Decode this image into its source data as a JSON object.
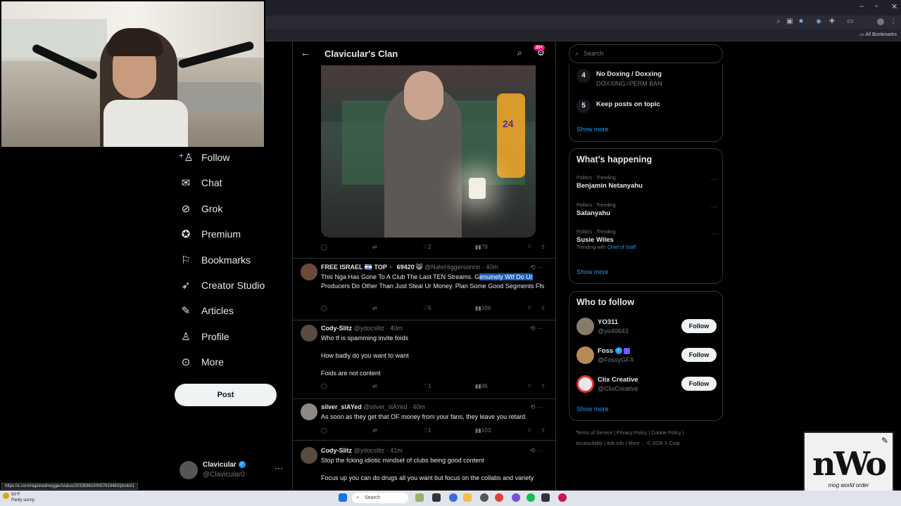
{
  "browser": {
    "window_controls": [
      "–",
      "▫",
      "✕"
    ],
    "bookmarks_folder": "All Bookmarks"
  },
  "nav": {
    "items": [
      {
        "label": "Follow",
        "icon": "follow-icon"
      },
      {
        "label": "Chat",
        "icon": "chat-icon"
      },
      {
        "label": "Grok",
        "icon": "grok-icon"
      },
      {
        "label": "Premium",
        "icon": "premium-icon"
      },
      {
        "label": "Bookmarks",
        "icon": "bookmark-icon"
      },
      {
        "label": "Creator Studio",
        "icon": "rocket-icon"
      },
      {
        "label": "Articles",
        "icon": "articles-icon"
      },
      {
        "label": "Profile",
        "icon": "profile-icon"
      },
      {
        "label": "More",
        "icon": "more-icon"
      }
    ],
    "post_label": "Post",
    "account": {
      "name": "Clavicular",
      "handle": "@Clavicular0"
    }
  },
  "header": {
    "title": "Clavicular's Clan",
    "badge": "20+"
  },
  "media_post": {
    "jersey_number": "24",
    "actions": {
      "replies": "",
      "reposts": "",
      "likes": "2",
      "views": "79"
    }
  },
  "tweets": [
    {
      "name": "FREE ISRAEL 🇮🇱 TOP▪️ 69420 😸",
      "handle": "@NateHiggersonnn",
      "time": "· 40m",
      "lines_pre": "This Nga Has Gone To A Club The Last TEN Streams. G",
      "lines_hl": "enuinely Wtf Do Ur",
      "lines_post": "Producers Do Other Than Just Steal Ur Money. Plan Some Good Segments Ffs",
      "likes": "5",
      "views": "106"
    },
    {
      "name": "Cody-Slitz",
      "handle": "@ydocslitz",
      "time": "· 40m",
      "line1": "Who tf is spamming invite foids",
      "line2": "How badly do you want to want",
      "line3": "Foids are not content",
      "likes": "1",
      "views": "86"
    },
    {
      "name": "silver_slAYed",
      "handle": "@silver_slAYed",
      "time": "· 40m",
      "line1": "As soon as they get that OF money from your fans, they leave you retard",
      "likes": "1",
      "views": "103"
    },
    {
      "name": "Cody-Slitz",
      "handle": "@ydocslitz",
      "time": "· 41m",
      "line1": "Stop the fcking idiotic mindset of clubs being good content",
      "line2": "Focus up you can do drugs all you want but focus on the collabs and variety"
    }
  ],
  "right": {
    "search_placeholder": "Search",
    "rules": [
      {
        "num": "4",
        "title": "No Doxing / Doxxing",
        "sub": "DOXXING=PERM BAN"
      },
      {
        "num": "5",
        "title": "Keep posts on topic",
        "sub": ""
      }
    ],
    "show_more": "Show more",
    "happening_title": "What’s happening",
    "trends": [
      {
        "cat": "Politics · Trending",
        "name": "Benjamin Netanyahu",
        "with": ""
      },
      {
        "cat": "Politics · Trending",
        "name": "Satanyahu",
        "with": ""
      },
      {
        "cat": "Politics · Trending",
        "name": "Susie Wiles",
        "with_prefix": "Trending with",
        "with": "Chief of Staff"
      }
    ],
    "wtf_title": "Who to follow",
    "follow_label": "Follow",
    "suggestions": [
      {
        "name": "YO311",
        "handle": "@yo40643"
      },
      {
        "name": "Foss",
        "handle": "@FossyGFX"
      },
      {
        "name": "Clix Creative",
        "handle": "@ClixCreative"
      }
    ],
    "footer_line1": "Terms of Service  |  Privacy Policy  |  Cookie Policy  |",
    "footer_line2": "Accessibility  |  Ads info  |  More ···  © 2026 X Corp."
  },
  "overlay": {
    "logo_text": "nWo",
    "logo_sub": "mog world order"
  },
  "status_url": "https://x.com/registredmogger/status/2033586150057619483/photo/1",
  "taskbar": {
    "weather_temp": "83°F",
    "weather_desc": "Partly sunny",
    "search": "Search"
  }
}
